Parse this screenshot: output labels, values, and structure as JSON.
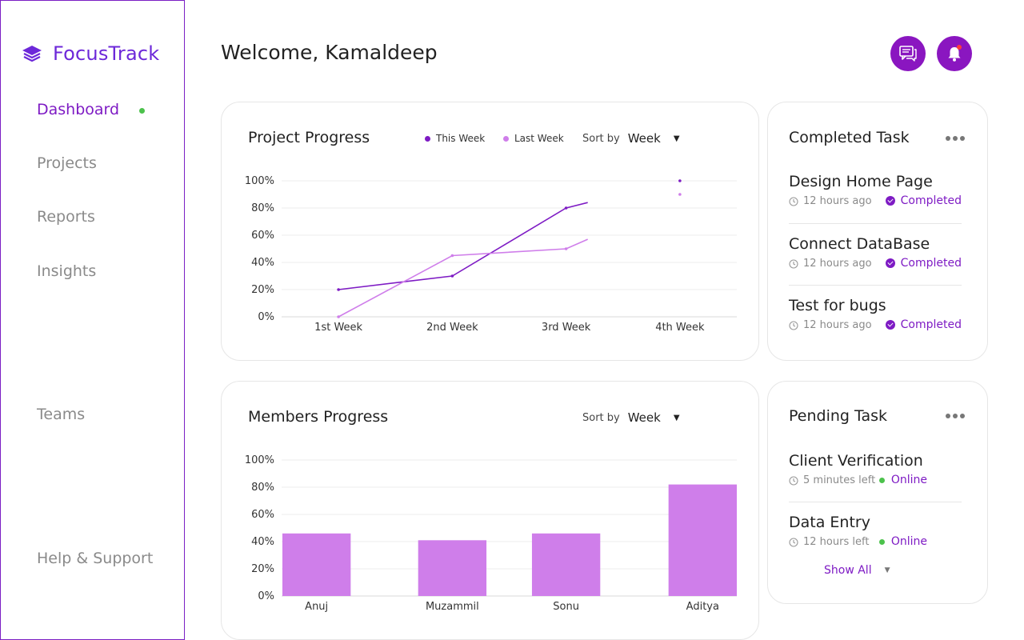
{
  "app": {
    "name": "FocusTrack"
  },
  "sidebar": {
    "items": [
      {
        "label": "Dashboard",
        "active": true
      },
      {
        "label": "Projects"
      },
      {
        "label": "Reports"
      },
      {
        "label": "Insights"
      },
      {
        "label": "Teams"
      },
      {
        "label": "Help & Support"
      }
    ]
  },
  "header": {
    "welcome": "Welcome, Kamaldeep",
    "icons": [
      "chat-icon",
      "bell-icon"
    ],
    "notification_count": "1"
  },
  "project_progress": {
    "title": "Project Progress",
    "legend": [
      "This Week",
      "Last Week"
    ],
    "sort_label": "Sort by",
    "sort_value": "Week"
  },
  "members_progress": {
    "title": "Members Progress",
    "sort_label": "Sort by",
    "sort_value": "Week"
  },
  "completed_tasks": {
    "title": "Completed Task",
    "items": [
      {
        "name": "Design Home Page",
        "time": "12 hours ago",
        "status": "Completed"
      },
      {
        "name": "Connect DataBase",
        "time": "12 hours ago",
        "status": "Completed"
      },
      {
        "name": "Test for bugs",
        "time": "12 hours ago",
        "status": "Completed"
      }
    ]
  },
  "pending_tasks": {
    "title": "Pending Task",
    "items": [
      {
        "name": "Client Verification",
        "time": "5 minutes left",
        "status": "Online"
      },
      {
        "name": "Data Entry",
        "time": "12 hours left",
        "status": "Online"
      }
    ],
    "show_all": "Show All"
  },
  "colors": {
    "accent": "#7e1bc4",
    "this_week": "#7e1bc4",
    "last_week": "#cf7eea",
    "bar": "#cf7eea",
    "online": "#4cc24c"
  },
  "chart_data": [
    {
      "type": "line",
      "title": "Project Progress",
      "categories": [
        "1st Week",
        "2nd Week",
        "3rd Week",
        "4th Week"
      ],
      "yticks": [
        "0%",
        "20%",
        "40%",
        "60%",
        "80%",
        "100%"
      ],
      "ylim": [
        0,
        100
      ],
      "series": [
        {
          "name": "This Week",
          "values": [
            20,
            30,
            80,
            100
          ],
          "tail": 84
        },
        {
          "name": "Last Week",
          "values": [
            0,
            45,
            50,
            90
          ],
          "tail": 57
        }
      ],
      "legend": "top"
    },
    {
      "type": "bar",
      "title": "Members Progress",
      "categories": [
        "Anuj",
        "Muzammil",
        "Sonu",
        "Aditya"
      ],
      "values": [
        46,
        41,
        46,
        82
      ],
      "yticks": [
        "0%",
        "20%",
        "40%",
        "60%",
        "80%",
        "100%"
      ],
      "ylim": [
        0,
        100
      ]
    }
  ]
}
